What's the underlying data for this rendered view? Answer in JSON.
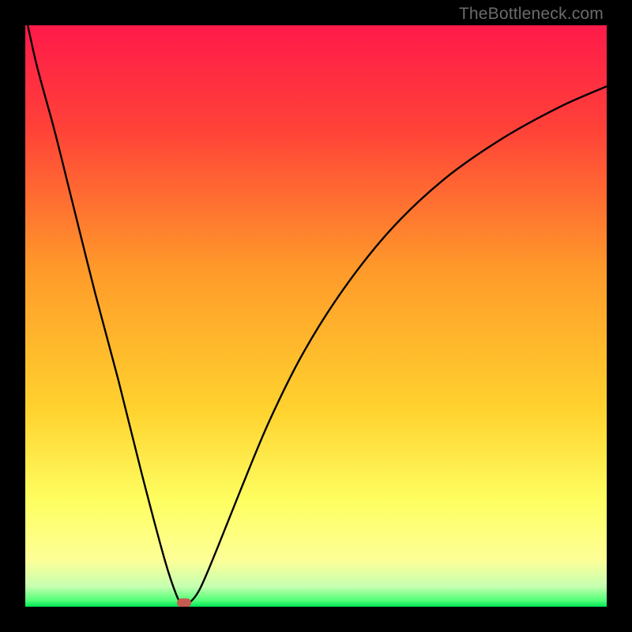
{
  "watermark": "TheBottleneck.com",
  "colors": {
    "frame": "#000000",
    "top": "#ff1a4a",
    "mid": "#ffd22e",
    "pale": "#fdff97",
    "green": "#00e456",
    "curve": "#000000",
    "marker": "#c55b50"
  },
  "chart_data": {
    "type": "line",
    "title": "",
    "xlabel": "",
    "ylabel": "",
    "xlim": [
      0,
      100
    ],
    "ylim": [
      0,
      100
    ],
    "x": [
      0,
      2,
      5,
      8,
      12,
      16,
      20,
      24,
      26,
      27,
      28,
      30,
      33,
      37,
      42,
      48,
      55,
      63,
      72,
      82,
      92,
      100
    ],
    "values": [
      102,
      93,
      82,
      70,
      54,
      39,
      23,
      8,
      2,
      0.5,
      0.5,
      3,
      10,
      20,
      32,
      44,
      55,
      65,
      73.5,
      80.5,
      86,
      89.5
    ],
    "marker": {
      "x": 27.3,
      "y": 0.7
    }
  }
}
